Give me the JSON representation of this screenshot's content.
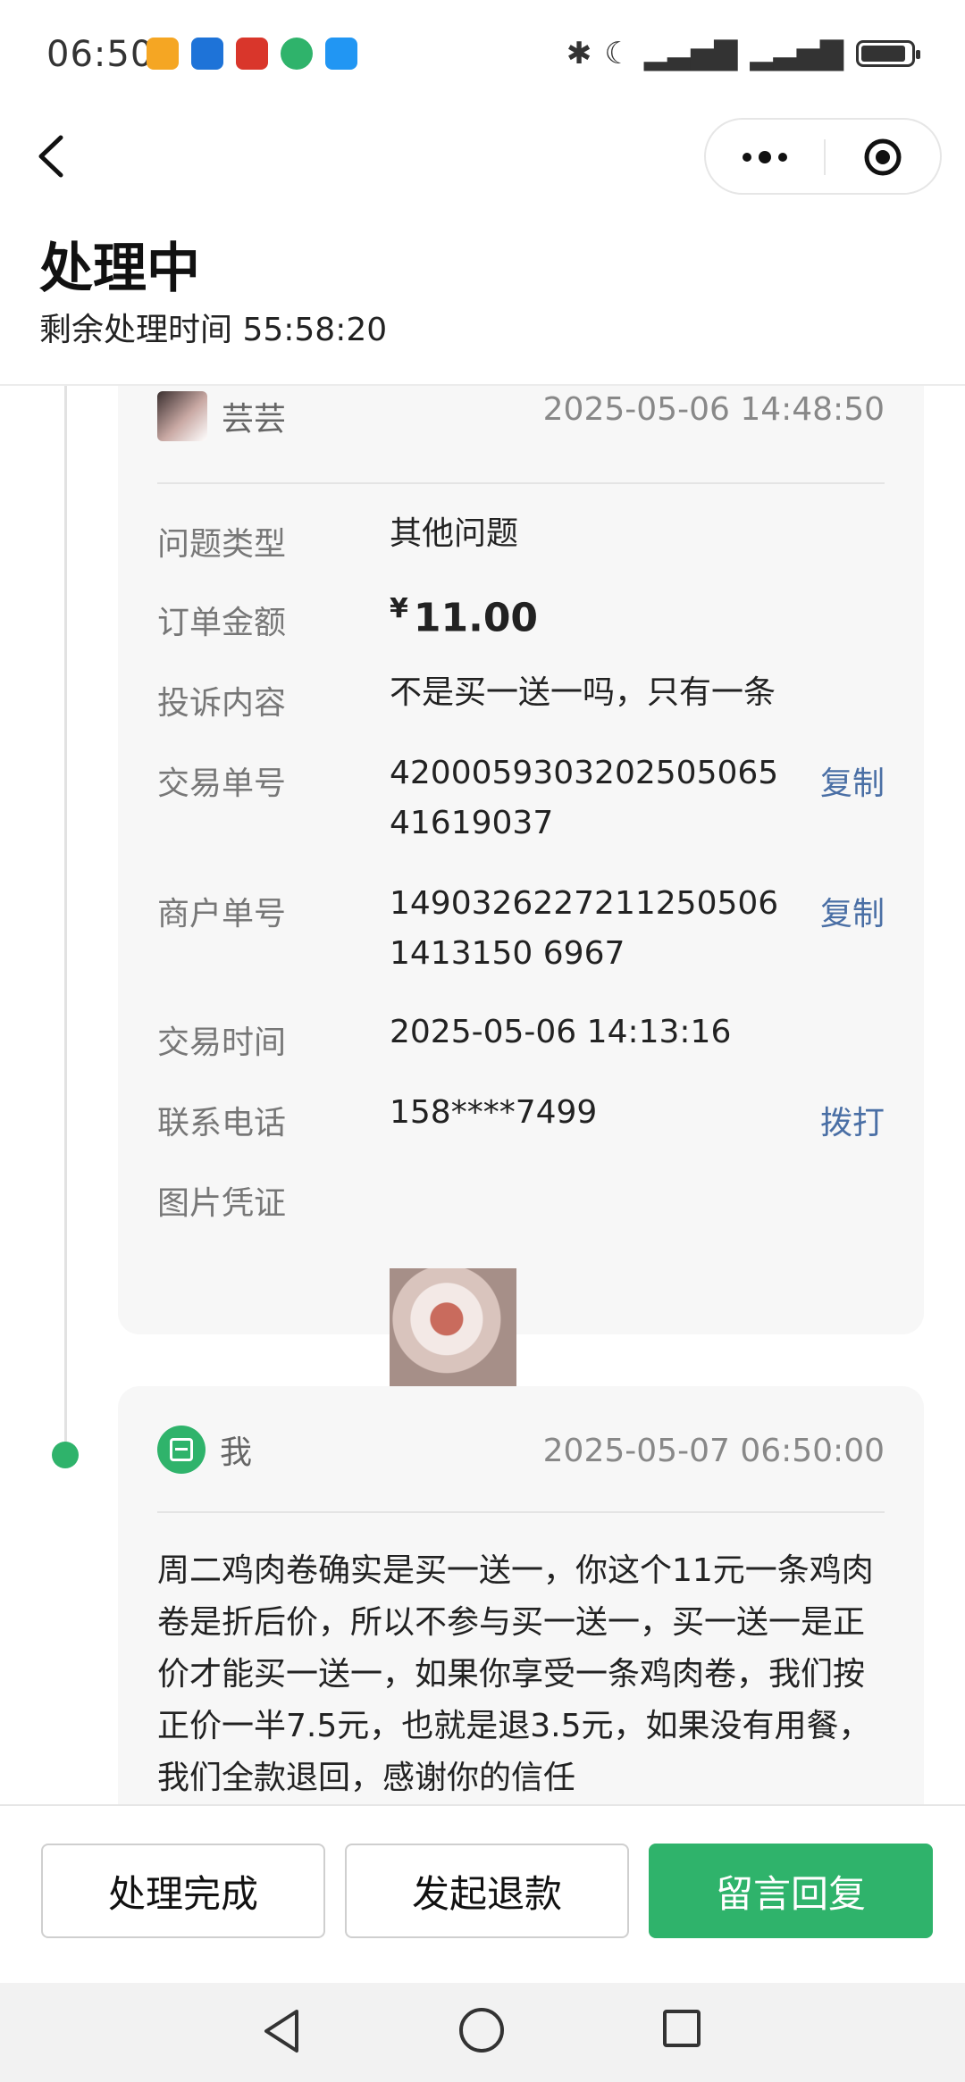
{
  "status_bar": {
    "time": "06:50",
    "battery_level": 0.9
  },
  "nav": {
    "more_icon": "more-dots-icon",
    "close_icon": "target-icon"
  },
  "header": {
    "title": "处理中",
    "subtitle": "剩余处理时间 55:58:20"
  },
  "complaint": {
    "author": "芸芸",
    "timestamp": "2025-05-06 14:48:50",
    "fields": {
      "type": {
        "label": "问题类型",
        "value": "其他问题"
      },
      "amount": {
        "label": "订单金额",
        "currency": "¥",
        "value": "11.00"
      },
      "content": {
        "label": "投诉内容",
        "value": "不是买一送一吗，只有一条"
      },
      "trade_no": {
        "label": "交易单号",
        "value": "420005930320250506541619037",
        "action": "复制"
      },
      "merchant_no": {
        "label": "商户单号",
        "value": "14903262272112505061413150 6967",
        "action": "复制"
      },
      "trade_time": {
        "label": "交易时间",
        "value": "2025-05-06 14:13:16"
      },
      "phone": {
        "label": "联系电话",
        "value": "158****7499",
        "action": "拨打"
      },
      "proof": {
        "label": "图片凭证"
      }
    }
  },
  "reply": {
    "author": "我",
    "timestamp": "2025-05-07 06:50:00",
    "message": "周二鸡肉卷确实是买一送一，你这个11元一条鸡肉卷是折后价，所以不参与买一送一，买一送一是正价才能买一送一，如果你享受一条鸡肉卷，我们按正价一半7.5元，也就是退3.5元，如果没有用餐，我们全款退回，感谢你的信任"
  },
  "actions": {
    "complete": "处理完成",
    "refund": "发起退款",
    "reply": "留言回复"
  },
  "colors": {
    "accent": "#2fb36b",
    "link": "#4a6fa5"
  }
}
